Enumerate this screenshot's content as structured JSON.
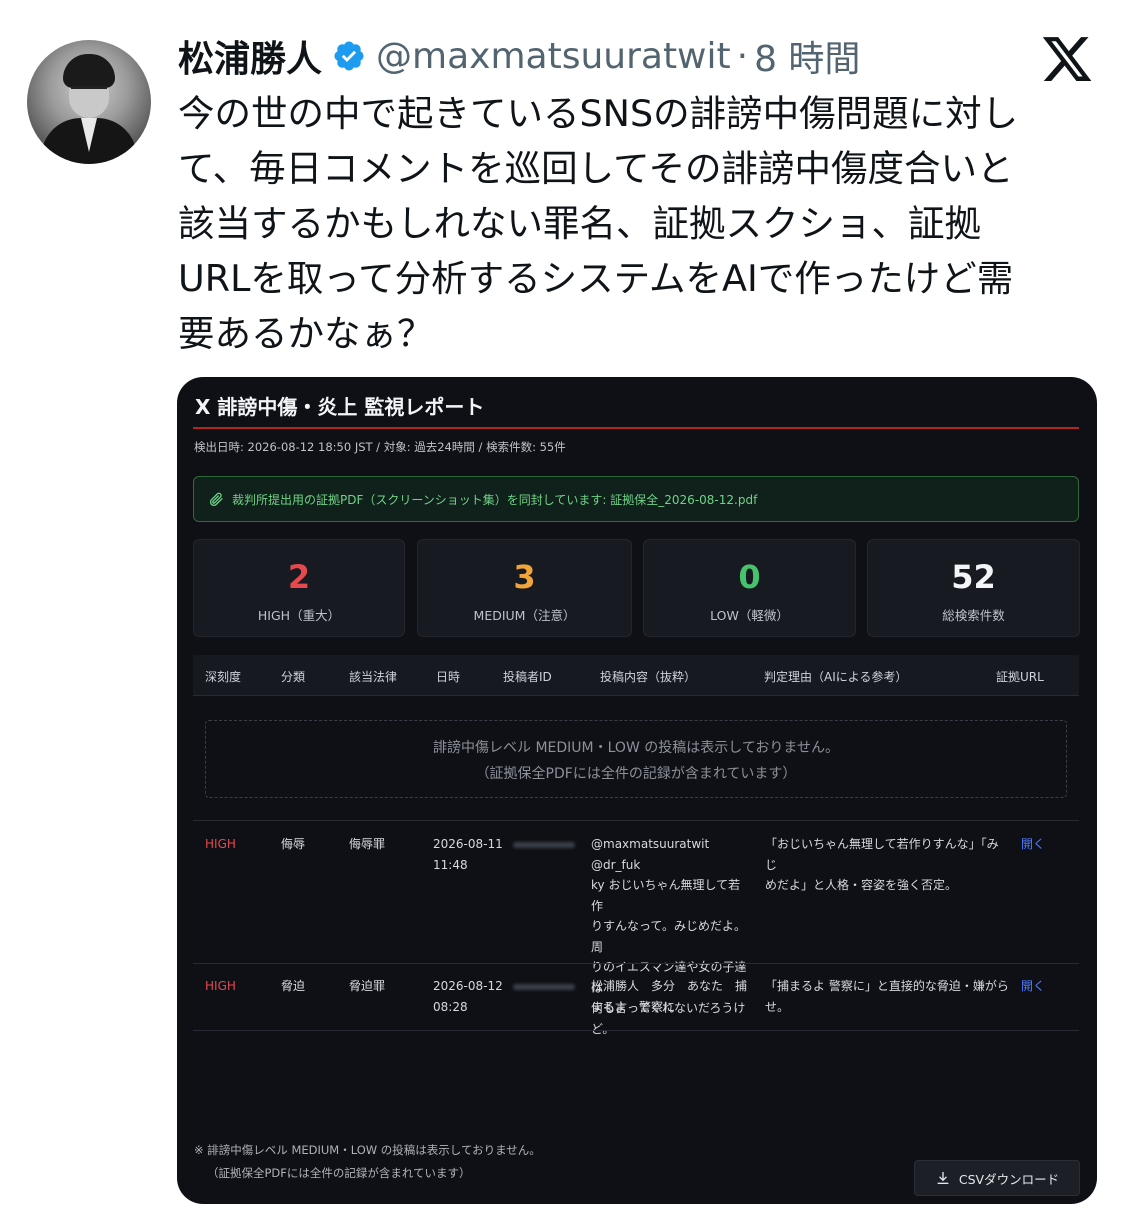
{
  "tweet": {
    "author_name": "松浦勝人",
    "handle": "@maxmatsuuratwit",
    "separator": "·",
    "time": "8 時間",
    "text_lines": [
      "今の世の中で起きているSNSの誹謗中傷問題に対し",
      "て、毎日コメントを巡回してその誹謗中傷度合いと",
      "該当するかもしれない罪名、証拠スクショ、証拠",
      "URLを取って分析するシステムをAIで作ったけど需",
      "要あるかなぁ？"
    ]
  },
  "report": {
    "title": "X 誹謗中傷・炎上 監視レポート",
    "meta": "検出日時: 2026-08-12 18:50 JST / 対象: 過去24時間 / 検索件数: 55件",
    "notice": "裁判所提出用の証拠PDF（スクリーンショット集）を同封しています: 証拠保全_2026-08-12.pdf",
    "stats": [
      {
        "value": "2",
        "label": "HIGH（重大）",
        "color": "#e5484d"
      },
      {
        "value": "3",
        "label": "MEDIUM（注意）",
        "color": "#f0a43a"
      },
      {
        "value": "0",
        "label": "LOW（軽微）",
        "color": "#46c36b"
      },
      {
        "value": "52",
        "label": "総検索件数",
        "color": "#f2f4f7"
      }
    ],
    "columns": [
      "深刻度",
      "分類",
      "該当法律",
      "日時",
      "投稿者ID",
      "投稿内容（抜粋）",
      "判定理由（AIによる参考）",
      "証拠URL"
    ],
    "hidden_notice_line1": "誹謗中傷レベル MEDIUM・LOW の投稿は表示しておりません。",
    "hidden_notice_line2": "（証拠保全PDFには全件の記録が含まれています）",
    "rows": [
      {
        "severity": "HIGH",
        "category": "侮辱",
        "law": "侮辱罪",
        "date": "2026-08-11",
        "time": "11:48",
        "content_lines": [
          "@maxmatsuuratwit @dr_fuk",
          "ky おじいちゃん無理して若作",
          "りすんなって。みじめだよ。周",
          "りのイエスマン達や女の子達は",
          "何も言ってくれないだろうけ",
          "ど。"
        ],
        "reason_lines": [
          "「おじいちゃん無理して若作りすんな」「みじ",
          "めだよ」と人格・容姿を強く否定。"
        ],
        "link": "開く"
      },
      {
        "severity": "HIGH",
        "category": "脅迫",
        "law": "脅迫罪",
        "date": "2026-08-12",
        "time": "08:28",
        "content_lines": [
          "松浦勝人　多分　あなた　捕",
          "まるよ　警察に"
        ],
        "reason_lines": [
          "「捕まるよ 警察に」と直接的な脅迫・嫌がらせ。"
        ],
        "link": "開く"
      }
    ],
    "footer_line1": "※ 誹謗中傷レベル MEDIUM・LOW の投稿は表示しておりません。",
    "footer_line2": "（証拠保全PDFには全件の記録が含まれています）",
    "csv_button": "CSVダウンロード"
  }
}
